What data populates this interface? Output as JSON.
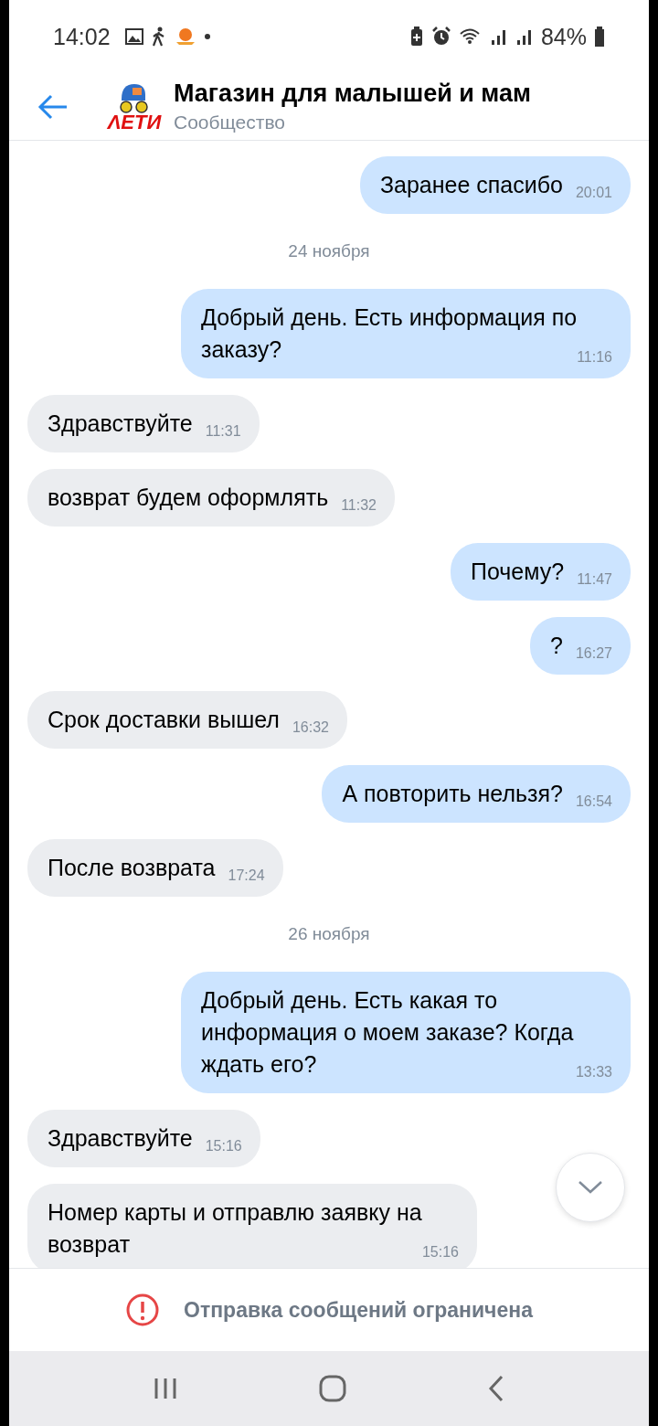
{
  "status_bar": {
    "time": "14:02",
    "battery": "84%"
  },
  "header": {
    "title": "Магазин для малышей и мам",
    "subtitle": "Сообщество",
    "logo_text": "ΛETИ"
  },
  "messages": [
    {
      "kind": "out",
      "text": "Заранее спасибо",
      "time": "20:01"
    },
    {
      "kind": "date",
      "text": "24 ноября"
    },
    {
      "kind": "out",
      "text": "Добрый день. Есть информация по заказу?",
      "time": "11:16"
    },
    {
      "kind": "in",
      "text": "Здравствуйте",
      "time": "11:31"
    },
    {
      "kind": "in",
      "text": "возврат будем оформлять",
      "time": "11:32"
    },
    {
      "kind": "out",
      "text": "Почему?",
      "time": "11:47"
    },
    {
      "kind": "out",
      "text": "?",
      "time": "16:27"
    },
    {
      "kind": "in",
      "text": "Срок доставки вышел",
      "time": "16:32"
    },
    {
      "kind": "out",
      "text": "А повторить нельзя?",
      "time": "16:54"
    },
    {
      "kind": "in",
      "text": "После возврата",
      "time": "17:24"
    },
    {
      "kind": "date",
      "text": "26 ноября"
    },
    {
      "kind": "out",
      "text": "Добрый день. Есть какая то информация о моем заказе? Когда ждать его?",
      "time": "13:33"
    },
    {
      "kind": "in",
      "text": "Здравствуйте",
      "time": "15:16"
    },
    {
      "kind": "in",
      "text": "Номер карты и отправлю заявку на возврат",
      "time": "15:16"
    }
  ],
  "footer": {
    "notice": "Отправка сообщений ограничена"
  }
}
